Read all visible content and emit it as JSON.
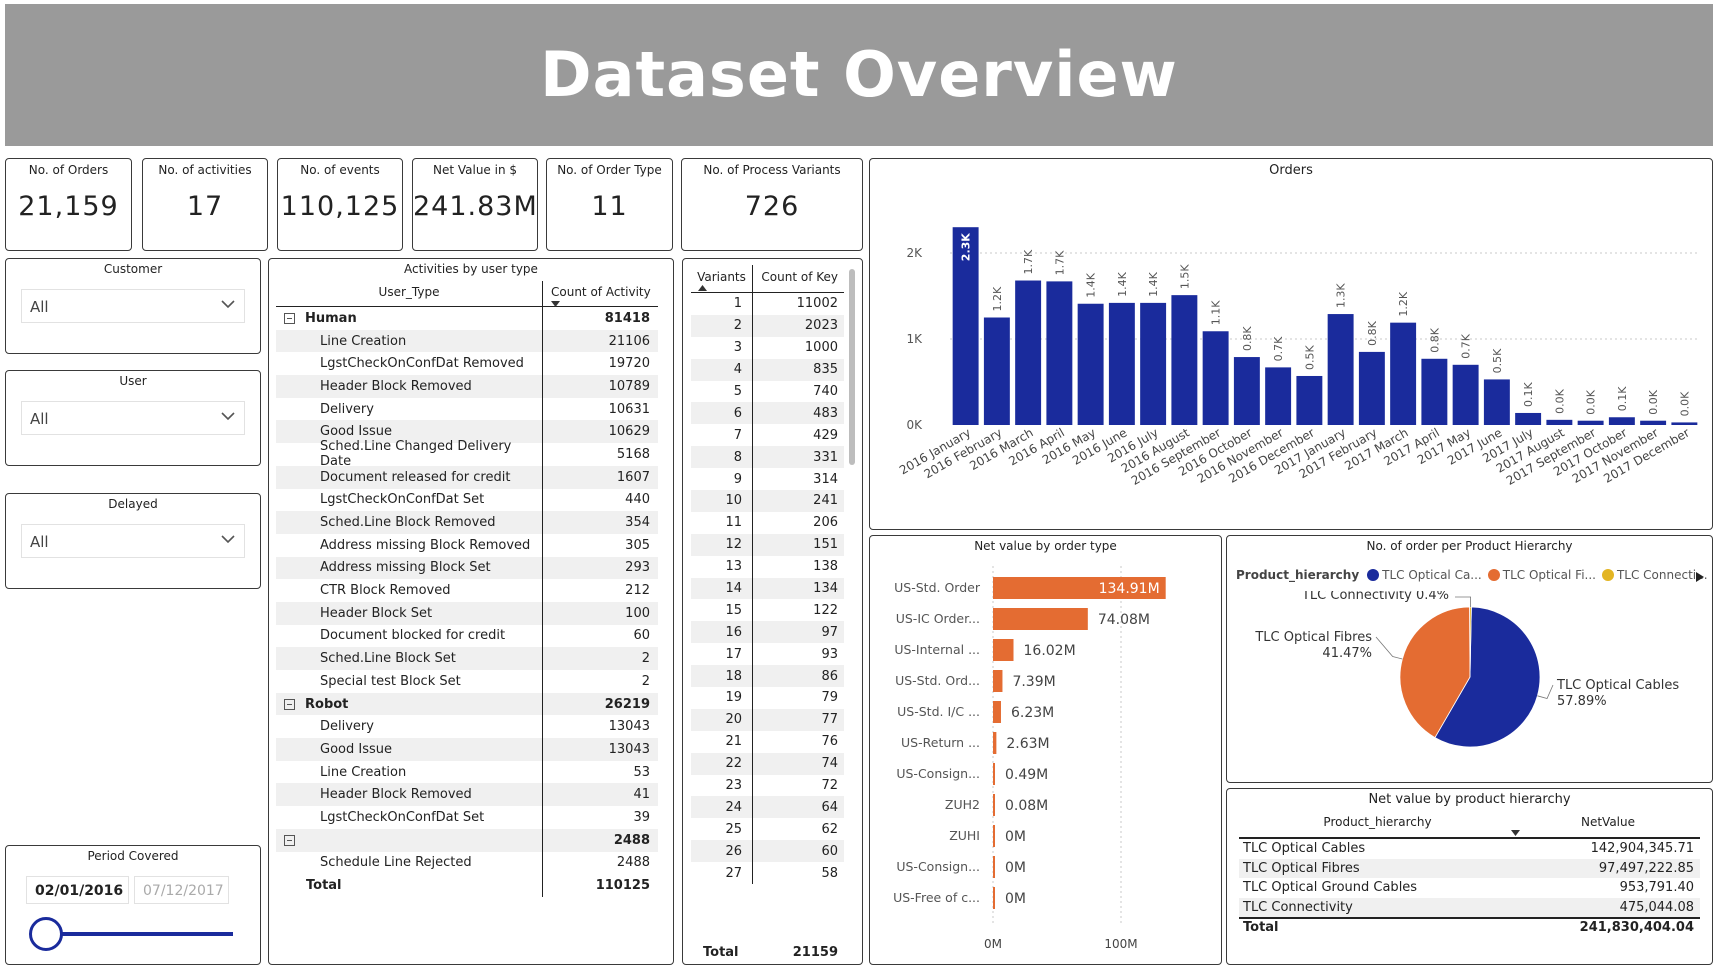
{
  "title": "Dataset Overview",
  "kpis": [
    {
      "label": "No. of Orders",
      "value": "21,159"
    },
    {
      "label": "No. of activities",
      "value": "17"
    },
    {
      "label": "No. of events",
      "value": "110,125"
    },
    {
      "label": "Net Value in $",
      "value": "241.83M"
    },
    {
      "label": "No. of Order Type",
      "value": "11"
    },
    {
      "label": "No. of Process Variants",
      "value": "726"
    }
  ],
  "filters": {
    "customer": {
      "label": "Customer",
      "value": "All"
    },
    "user": {
      "label": "User",
      "value": "All"
    },
    "delayed": {
      "label": "Delayed",
      "value": "All"
    }
  },
  "period": {
    "label": "Period Covered",
    "start": "02/01/2016",
    "end": "07/12/2017",
    "slider_position": 0
  },
  "activities": {
    "title": "Activities by user type",
    "col1": "User_Type",
    "col2": "Count of Activity",
    "rows": [
      {
        "kind": "group",
        "label": "Human",
        "value": "81418"
      },
      {
        "kind": "child",
        "label": "Line Creation",
        "value": "21106"
      },
      {
        "kind": "child",
        "label": "LgstCheckOnConfDat Removed",
        "value": "19720"
      },
      {
        "kind": "child",
        "label": "Header Block Removed",
        "value": "10789"
      },
      {
        "kind": "child",
        "label": "Delivery",
        "value": "10631"
      },
      {
        "kind": "child",
        "label": "Good Issue",
        "value": "10629"
      },
      {
        "kind": "child",
        "label": "Sched.Line Changed Delivery Date",
        "value": "5168"
      },
      {
        "kind": "child",
        "label": "Document released for credit",
        "value": "1607"
      },
      {
        "kind": "child",
        "label": "LgstCheckOnConfDat Set",
        "value": "440"
      },
      {
        "kind": "child",
        "label": "Sched.Line Block Removed",
        "value": "354"
      },
      {
        "kind": "child",
        "label": "Address missing Block Removed",
        "value": "305"
      },
      {
        "kind": "child",
        "label": "Address missing Block Set",
        "value": "293"
      },
      {
        "kind": "child",
        "label": "CTR Block Removed",
        "value": "212"
      },
      {
        "kind": "child",
        "label": "Header Block Set",
        "value": "100"
      },
      {
        "kind": "child",
        "label": "Document blocked for credit",
        "value": "60"
      },
      {
        "kind": "child",
        "label": "Sched.Line Block Set",
        "value": "2"
      },
      {
        "kind": "child",
        "label": "Special test Block Set",
        "value": "2"
      },
      {
        "kind": "group",
        "label": "Robot",
        "value": "26219"
      },
      {
        "kind": "child",
        "label": "Delivery",
        "value": "13043"
      },
      {
        "kind": "child",
        "label": "Good Issue",
        "value": "13043"
      },
      {
        "kind": "child",
        "label": "Line Creation",
        "value": "53"
      },
      {
        "kind": "child",
        "label": "Header Block Removed",
        "value": "41"
      },
      {
        "kind": "child",
        "label": "LgstCheckOnConfDat Set",
        "value": "39"
      },
      {
        "kind": "group",
        "label": "",
        "value": "2488"
      },
      {
        "kind": "child",
        "label": "Schedule Line Rejected",
        "value": "2488"
      },
      {
        "kind": "total",
        "label": "Total",
        "value": "110125"
      }
    ]
  },
  "variants": {
    "col1": "Variants",
    "col2": "Count of Key",
    "rows": [
      [
        "1",
        "11002"
      ],
      [
        "2",
        "2023"
      ],
      [
        "3",
        "1000"
      ],
      [
        "4",
        "835"
      ],
      [
        "5",
        "740"
      ],
      [
        "6",
        "483"
      ],
      [
        "7",
        "429"
      ],
      [
        "8",
        "331"
      ],
      [
        "9",
        "314"
      ],
      [
        "10",
        "241"
      ],
      [
        "11",
        "206"
      ],
      [
        "12",
        "151"
      ],
      [
        "13",
        "138"
      ],
      [
        "14",
        "134"
      ],
      [
        "15",
        "122"
      ],
      [
        "16",
        "97"
      ],
      [
        "17",
        "93"
      ],
      [
        "18",
        "86"
      ],
      [
        "19",
        "79"
      ],
      [
        "20",
        "77"
      ],
      [
        "21",
        "76"
      ],
      [
        "22",
        "74"
      ],
      [
        "23",
        "72"
      ],
      [
        "24",
        "64"
      ],
      [
        "25",
        "62"
      ],
      [
        "26",
        "60"
      ],
      [
        "27",
        "58"
      ]
    ],
    "total_label": "Total",
    "total_value": "21159"
  },
  "orders_chart": {
    "title": "Orders",
    "color": "#1a2b9c",
    "yticks": [
      "0K",
      "1K",
      "2K"
    ],
    "ymax": 2500,
    "categories": [
      "2016 January",
      "2016 February",
      "2016 March",
      "2016 April",
      "2016 May",
      "2016 June",
      "2016 July",
      "2016 August",
      "2016 September",
      "2016 October",
      "2016 November",
      "2016 December",
      "2017 January",
      "2017 February",
      "2017 March",
      "2017 April",
      "2017 May",
      "2017 June",
      "2017 July",
      "2017 August",
      "2017 September",
      "2017 October",
      "2017 November",
      "2017 December"
    ],
    "values": [
      2300,
      1250,
      1680,
      1670,
      1410,
      1420,
      1420,
      1510,
      1090,
      790,
      670,
      570,
      1290,
      850,
      1190,
      770,
      700,
      530,
      140,
      60,
      50,
      90,
      50,
      30
    ],
    "labels": [
      "2.3K",
      "1.2K",
      "1.7K",
      "1.7K",
      "1.4K",
      "1.4K",
      "1.4K",
      "1.5K",
      "1.1K",
      "0.8K",
      "0.7K",
      "0.5K",
      "1.3K",
      "0.8K",
      "1.2K",
      "0.8K",
      "0.7K",
      "0.5K",
      "0.1K",
      "0.0K",
      "0.0K",
      "0.1K",
      "0.0K",
      "0.0K"
    ]
  },
  "net_value_chart": {
    "title": "Net value by order type",
    "color": "#e46c32",
    "xticks": [
      "0M",
      "100M"
    ],
    "categories": [
      "US-Std. Order",
      "US-IC Order...",
      "US-Internal ...",
      "US-Std. Ord...",
      "US-Std. I/C ...",
      "US-Return ...",
      "US-Consign...",
      "ZUH2",
      "ZUHI",
      "US-Consign...",
      "US-Free of c..."
    ],
    "values": [
      134.91,
      74.08,
      16.02,
      7.39,
      6.23,
      2.63,
      0.49,
      0.08,
      0,
      0,
      0
    ],
    "labels": [
      "134.91M",
      "74.08M",
      "16.02M",
      "7.39M",
      "6.23M",
      "2.63M",
      "0.49M",
      "0.08M",
      "0M",
      "0M",
      "0M"
    ]
  },
  "pie_chart": {
    "title": "No. of order per Product Hierarchy",
    "legend_title": "Product_hierarchy",
    "legend": [
      {
        "label": "TLC Optical Ca...",
        "color": "#1a2b9c"
      },
      {
        "label": "TLC Optical Fi...",
        "color": "#e46c32"
      },
      {
        "label": "TLC Connecti...",
        "color": "#e3b523"
      }
    ],
    "slices": [
      {
        "name": "TLC Optical Cables",
        "pct": "57.89%",
        "value": 57.89,
        "color": "#1a2b9c"
      },
      {
        "name": "TLC Optical Fibres",
        "pct": "41.47%",
        "value": 41.47,
        "color": "#e46c32"
      },
      {
        "name": "TLC Connectivity",
        "pct": "0.4%",
        "value": 0.4,
        "color": "#e3b523"
      }
    ]
  },
  "product_table": {
    "title": "Net value by product hierarchy",
    "col1": "Product_hierarchy",
    "col2": "NetValue",
    "rows": [
      [
        "TLC Optical Cables",
        "142,904,345.71"
      ],
      [
        "TLC Optical Fibres",
        "97,497,222.85"
      ],
      [
        "TLC Optical Ground Cables",
        "953,791.40"
      ],
      [
        "TLC Connectivity",
        "475,044.08"
      ]
    ],
    "total_label": "Total",
    "total_value": "241,830,404.04"
  }
}
